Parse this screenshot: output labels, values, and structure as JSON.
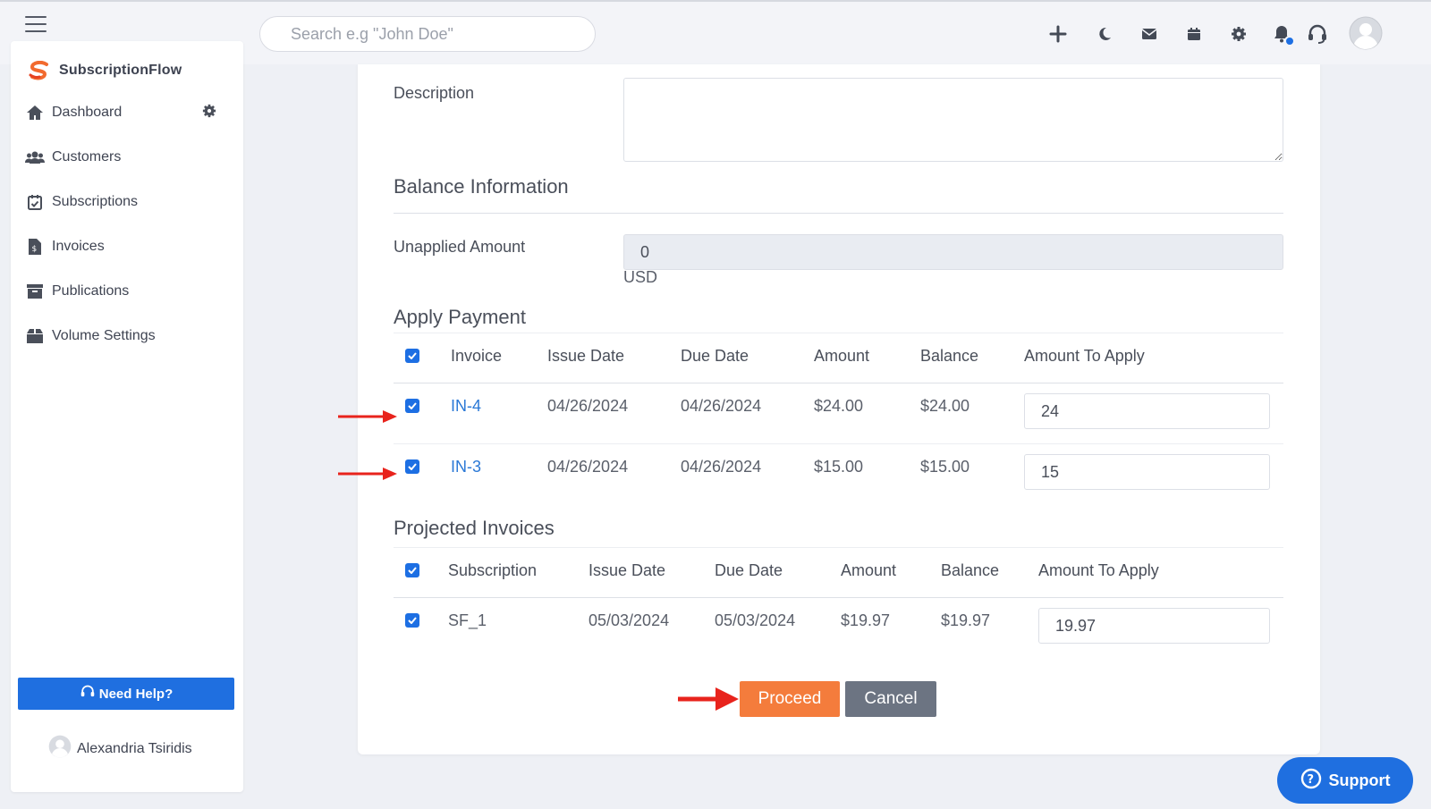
{
  "header": {
    "search_placeholder": "Search e.g \"John Doe\"",
    "icons": [
      "plus-icon",
      "moon-icon",
      "envelope-icon",
      "calendar-icon",
      "gear-icon",
      "bell-icon",
      "headset-icon",
      "avatar-icon"
    ]
  },
  "sidebar": {
    "brand": "SubscriptionFlow",
    "items": [
      {
        "label": "Dashboard",
        "icon": "home-icon"
      },
      {
        "label": "Customers",
        "icon": "users-icon"
      },
      {
        "label": "Subscriptions",
        "icon": "calendar-check-icon"
      },
      {
        "label": "Invoices",
        "icon": "invoice-icon"
      },
      {
        "label": "Publications",
        "icon": "archive-icon"
      },
      {
        "label": "Volume Settings",
        "icon": "box-icon"
      }
    ],
    "help_label": "Need Help?",
    "user_name": "Alexandria Tsiridis"
  },
  "form": {
    "description_label": "Description",
    "balance_title": "Balance Information",
    "unapplied_label": "Unapplied Amount",
    "unapplied_value": "0",
    "currency": "USD",
    "apply_title": "Apply Payment",
    "apply_headers": [
      "Invoice",
      "Issue Date",
      "Due Date",
      "Amount",
      "Balance",
      "Amount To Apply"
    ],
    "apply_rows": [
      {
        "invoice": "IN-4",
        "issue_date": "04/26/2024",
        "due_date": "04/26/2024",
        "amount": "$24.00",
        "balance": "$24.00",
        "apply": "24"
      },
      {
        "invoice": "IN-3",
        "issue_date": "04/26/2024",
        "due_date": "04/26/2024",
        "amount": "$15.00",
        "balance": "$15.00",
        "apply": "15"
      }
    ],
    "projected_title": "Projected Invoices",
    "projected_headers": [
      "Subscription",
      "Issue Date",
      "Due Date",
      "Amount",
      "Balance",
      "Amount To Apply"
    ],
    "projected_rows": [
      {
        "subscription": "SF_1",
        "issue_date": "05/03/2024",
        "due_date": "05/03/2024",
        "amount": "$19.97",
        "balance": "$19.97",
        "apply": "19.97"
      }
    ],
    "proceed_label": "Proceed",
    "cancel_label": "Cancel"
  },
  "support_label": "Support",
  "colors": {
    "primary": "#1f6fe0",
    "proceed": "#f47c3c",
    "cancel": "#6c7482",
    "annotation_arrow": "#e8231c"
  }
}
